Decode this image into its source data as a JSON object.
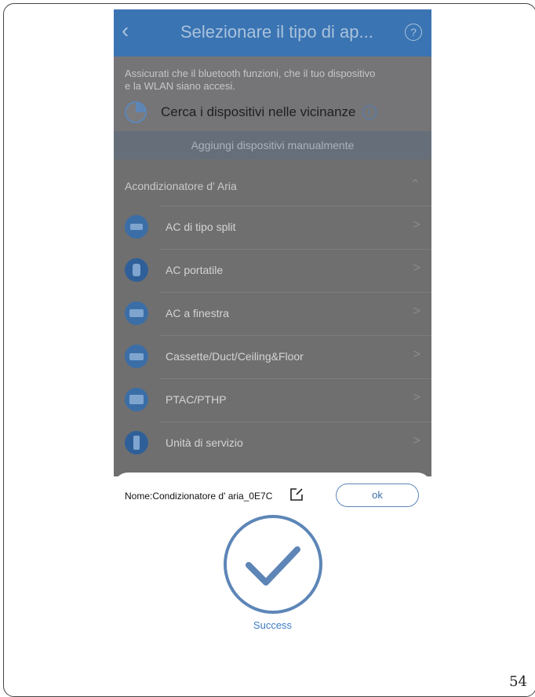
{
  "header": {
    "back_icon": "chevron-left-icon",
    "title": "Selezionare il tipo di ap...",
    "help_icon": "question-circle-icon",
    "help_glyph": "?"
  },
  "hint": {
    "text": "Assicurati che il bluetooth funzioni, che il tuo dispositivo e la WLAN siano accesi.",
    "search_label": "Cerca i dispositivi nelle vicinanze",
    "info_glyph": "i"
  },
  "manual_add_label": "Aggiungi dispositivi manualmente",
  "section": {
    "title": "Acondizionatore d' Aria",
    "toggle_glyph": "^"
  },
  "devices": [
    {
      "label": "AC di tipo split",
      "icon": "split-ac-icon"
    },
    {
      "label": "AC portatile",
      "icon": "portable-ac-icon"
    },
    {
      "label": "AC a finestra",
      "icon": "window-ac-icon"
    },
    {
      "label": "Cassette/Duct/Ceiling&Floor",
      "icon": "cassette-ac-icon"
    },
    {
      "label": "PTAC/PTHP",
      "icon": "ptac-icon"
    },
    {
      "label": "Unità di servizio",
      "icon": "service-unit-icon"
    }
  ],
  "list_arrow_glyph": ">",
  "sheet": {
    "name_label": "Nome:Condizionatore d' aria_0E7C",
    "ok_label": "ok",
    "success_label": "Success"
  },
  "page_number": "54",
  "colors": {
    "accent": "#3a74b3",
    "success": "#5d86b7"
  }
}
